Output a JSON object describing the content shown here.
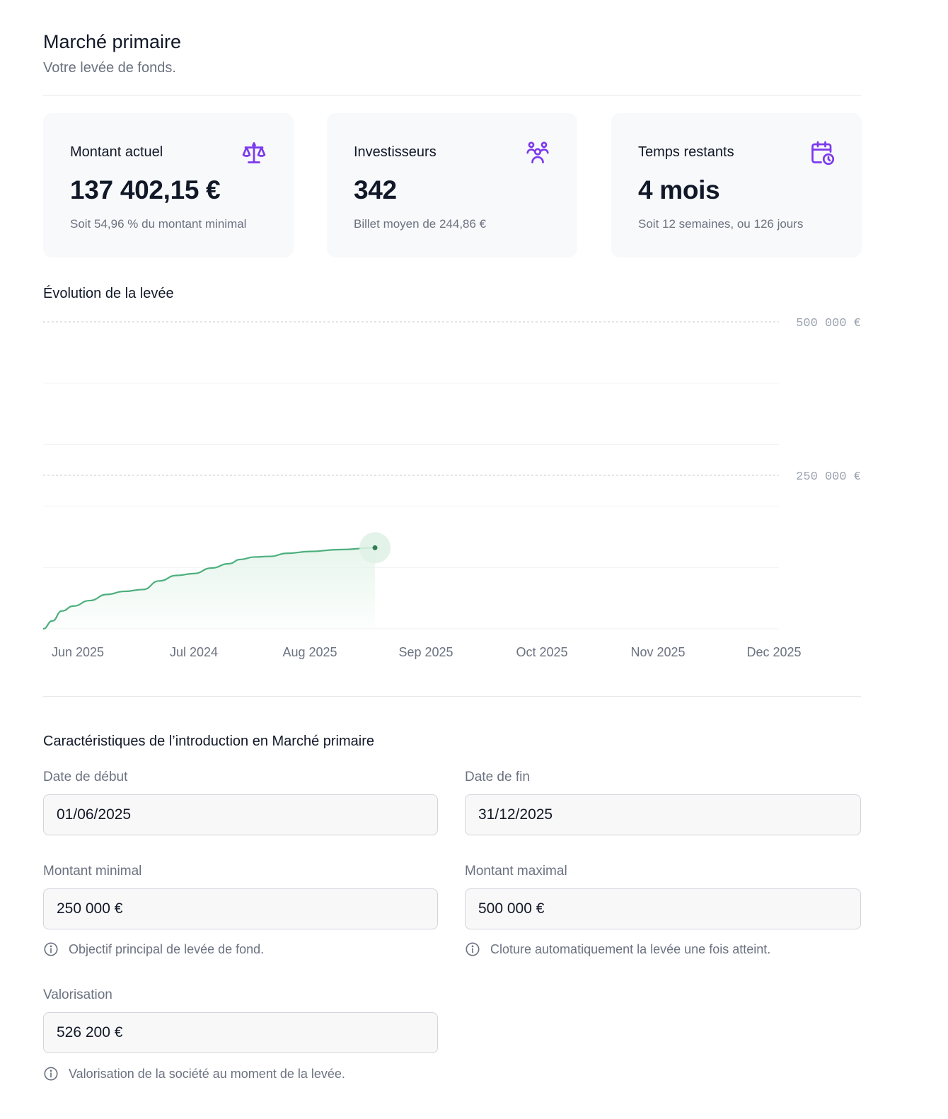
{
  "header": {
    "title": "Marché primaire",
    "subtitle": "Votre levée de fonds."
  },
  "cards": [
    {
      "label": "Montant actuel",
      "value": "137 402,15 €",
      "sub": "Soit 54,96 % du montant minimal",
      "icon": "scale-icon"
    },
    {
      "label": "Investisseurs",
      "value": "342",
      "sub": "Billet moyen de 244,86 €",
      "icon": "users-icon"
    },
    {
      "label": "Temps restants",
      "value": "4 mois",
      "sub": "Soit 12 semaines, ou 126 jours",
      "icon": "calendar-clock-icon"
    }
  ],
  "colors": {
    "accent": "#7c3aed",
    "line": "#4caf7d",
    "area": "#e6f5ec"
  },
  "chart_data": {
    "type": "area",
    "title": "Évolution de la levée",
    "x_labels": [
      "Jun 2025",
      "Jul 2024",
      "Aug 2025",
      "Sep 2025",
      "Oct 2025",
      "Nov 2025",
      "Dec 2025"
    ],
    "y_tick_labels": [
      "500 000 €",
      "250 000 €"
    ],
    "y_ticks": [
      500000,
      250000
    ],
    "ylim": [
      0,
      500000
    ],
    "grid": true,
    "series": [
      {
        "points": [
          [
            0.0,
            0
          ],
          [
            0.08,
            13000
          ],
          [
            0.16,
            29000
          ],
          [
            0.26,
            37000
          ],
          [
            0.4,
            46000
          ],
          [
            0.55,
            56000
          ],
          [
            0.7,
            61000
          ],
          [
            0.86,
            64000
          ],
          [
            1.0,
            78000
          ],
          [
            1.15,
            87000
          ],
          [
            1.3,
            90000
          ],
          [
            1.45,
            99000
          ],
          [
            1.6,
            106000
          ],
          [
            1.7,
            113000
          ],
          [
            1.82,
            117000
          ],
          [
            1.96,
            118000
          ],
          [
            2.1,
            123000
          ],
          [
            2.3,
            126000
          ],
          [
            2.55,
            129000
          ],
          [
            2.86,
            132000
          ]
        ]
      }
    ]
  },
  "details": {
    "title": "Caractéristiques de l’introduction en Marché primaire",
    "start_label": "Date de début",
    "start_value": "01/06/2025",
    "end_label": "Date de fin",
    "end_value": "31/12/2025",
    "min_label": "Montant minimal",
    "min_value": "250 000 €",
    "min_hint": "Objectif principal de levée de fond.",
    "max_label": "Montant maximal",
    "max_value": "500 000 €",
    "max_hint": "Cloture automatiquement la levée une fois atteint.",
    "val_label": "Valorisation",
    "val_value": "526 200 €",
    "val_hint": "Valorisation de la société au moment de la levée."
  }
}
